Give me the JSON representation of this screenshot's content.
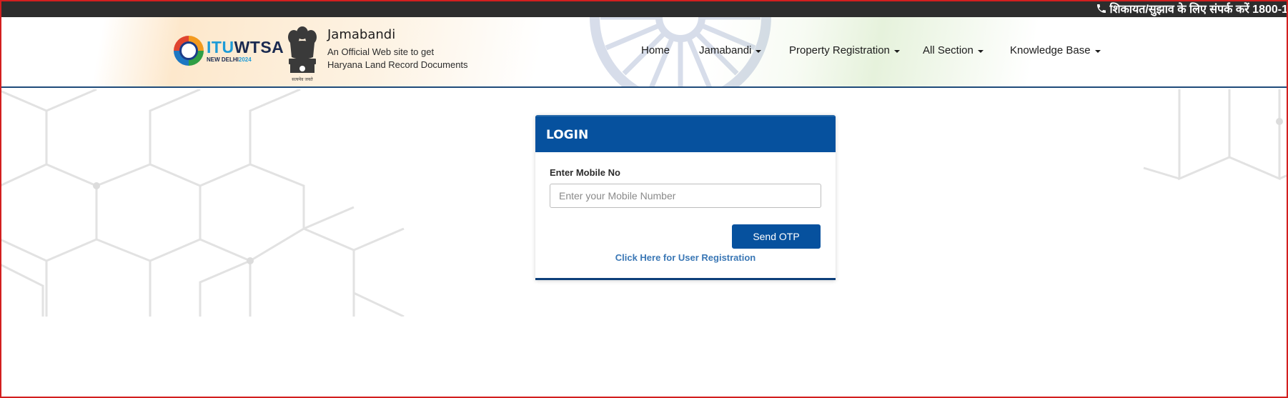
{
  "ticker": {
    "text": "शिकायत/सुझाव के लिए संपर्क करें 1800-1",
    "icon": "phone-icon"
  },
  "header": {
    "itu_logo": {
      "main_part1": "ITU",
      "main_part2": "WTSA",
      "sub_part1": "NEW DELHI",
      "sub_part2": "2024"
    },
    "emblem_caption": "सत्यमेव जयते",
    "site_title": "Jamabandi",
    "site_sub1": "An Official Web site to get",
    "site_sub2": "Haryana Land Record Documents"
  },
  "nav": {
    "items": [
      {
        "label": "Home",
        "has_caret": false
      },
      {
        "label": "Jamabandi",
        "has_caret": true
      },
      {
        "label": "Property Registration",
        "has_caret": true
      },
      {
        "label": "All Section",
        "has_caret": true
      },
      {
        "label": "Knowledge Base",
        "has_caret": true
      }
    ]
  },
  "login": {
    "title": "LOGIN",
    "mobile_label": "Enter Mobile No",
    "mobile_value": "",
    "mobile_placeholder": "Enter your Mobile Number",
    "send_otp_label": "Send OTP",
    "registration_link": "Click Here for User Registration"
  },
  "colors": {
    "primary_blue": "#06519e",
    "ticker_bg": "#2d2d2d",
    "link_blue": "#3a77b5"
  }
}
